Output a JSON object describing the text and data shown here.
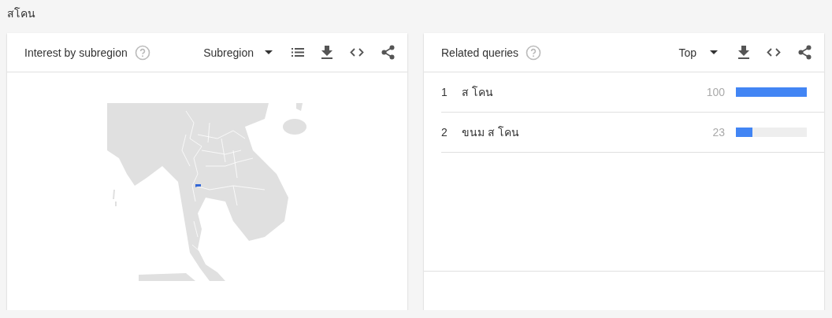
{
  "page_title": "สโคน",
  "interest_card": {
    "title": "Interest by subregion",
    "dropdown": "Subregion"
  },
  "queries_card": {
    "title": "Related queries",
    "dropdown": "Top",
    "rows": [
      {
        "rank": "1",
        "query": "ส โคน",
        "value": "100",
        "level": 1
      },
      {
        "rank": "2",
        "query": "ขนม ส โคน",
        "value": "23",
        "level": 0.23
      }
    ]
  }
}
